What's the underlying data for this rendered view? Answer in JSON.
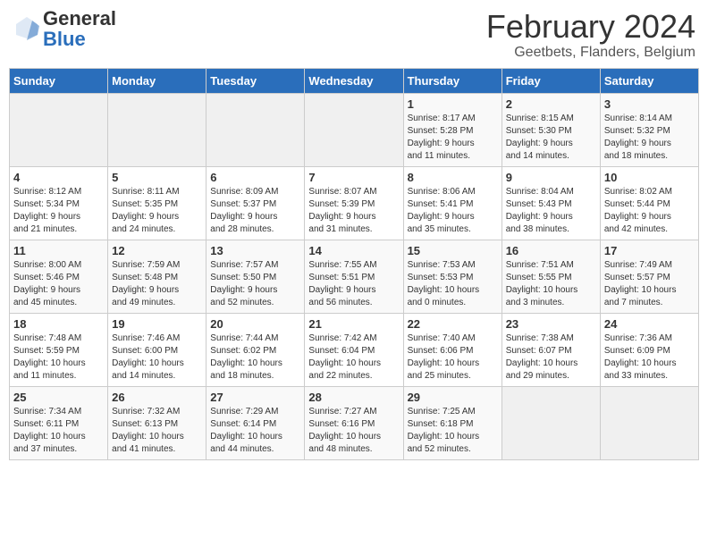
{
  "logo": {
    "general": "General",
    "blue": "Blue"
  },
  "header": {
    "month": "February 2024",
    "location": "Geetbets, Flanders, Belgium"
  },
  "weekdays": [
    "Sunday",
    "Monday",
    "Tuesday",
    "Wednesday",
    "Thursday",
    "Friday",
    "Saturday"
  ],
  "weeks": [
    [
      {
        "day": "",
        "info": ""
      },
      {
        "day": "",
        "info": ""
      },
      {
        "day": "",
        "info": ""
      },
      {
        "day": "",
        "info": ""
      },
      {
        "day": "1",
        "info": "Sunrise: 8:17 AM\nSunset: 5:28 PM\nDaylight: 9 hours\nand 11 minutes."
      },
      {
        "day": "2",
        "info": "Sunrise: 8:15 AM\nSunset: 5:30 PM\nDaylight: 9 hours\nand 14 minutes."
      },
      {
        "day": "3",
        "info": "Sunrise: 8:14 AM\nSunset: 5:32 PM\nDaylight: 9 hours\nand 18 minutes."
      }
    ],
    [
      {
        "day": "4",
        "info": "Sunrise: 8:12 AM\nSunset: 5:34 PM\nDaylight: 9 hours\nand 21 minutes."
      },
      {
        "day": "5",
        "info": "Sunrise: 8:11 AM\nSunset: 5:35 PM\nDaylight: 9 hours\nand 24 minutes."
      },
      {
        "day": "6",
        "info": "Sunrise: 8:09 AM\nSunset: 5:37 PM\nDaylight: 9 hours\nand 28 minutes."
      },
      {
        "day": "7",
        "info": "Sunrise: 8:07 AM\nSunset: 5:39 PM\nDaylight: 9 hours\nand 31 minutes."
      },
      {
        "day": "8",
        "info": "Sunrise: 8:06 AM\nSunset: 5:41 PM\nDaylight: 9 hours\nand 35 minutes."
      },
      {
        "day": "9",
        "info": "Sunrise: 8:04 AM\nSunset: 5:43 PM\nDaylight: 9 hours\nand 38 minutes."
      },
      {
        "day": "10",
        "info": "Sunrise: 8:02 AM\nSunset: 5:44 PM\nDaylight: 9 hours\nand 42 minutes."
      }
    ],
    [
      {
        "day": "11",
        "info": "Sunrise: 8:00 AM\nSunset: 5:46 PM\nDaylight: 9 hours\nand 45 minutes."
      },
      {
        "day": "12",
        "info": "Sunrise: 7:59 AM\nSunset: 5:48 PM\nDaylight: 9 hours\nand 49 minutes."
      },
      {
        "day": "13",
        "info": "Sunrise: 7:57 AM\nSunset: 5:50 PM\nDaylight: 9 hours\nand 52 minutes."
      },
      {
        "day": "14",
        "info": "Sunrise: 7:55 AM\nSunset: 5:51 PM\nDaylight: 9 hours\nand 56 minutes."
      },
      {
        "day": "15",
        "info": "Sunrise: 7:53 AM\nSunset: 5:53 PM\nDaylight: 10 hours\nand 0 minutes."
      },
      {
        "day": "16",
        "info": "Sunrise: 7:51 AM\nSunset: 5:55 PM\nDaylight: 10 hours\nand 3 minutes."
      },
      {
        "day": "17",
        "info": "Sunrise: 7:49 AM\nSunset: 5:57 PM\nDaylight: 10 hours\nand 7 minutes."
      }
    ],
    [
      {
        "day": "18",
        "info": "Sunrise: 7:48 AM\nSunset: 5:59 PM\nDaylight: 10 hours\nand 11 minutes."
      },
      {
        "day": "19",
        "info": "Sunrise: 7:46 AM\nSunset: 6:00 PM\nDaylight: 10 hours\nand 14 minutes."
      },
      {
        "day": "20",
        "info": "Sunrise: 7:44 AM\nSunset: 6:02 PM\nDaylight: 10 hours\nand 18 minutes."
      },
      {
        "day": "21",
        "info": "Sunrise: 7:42 AM\nSunset: 6:04 PM\nDaylight: 10 hours\nand 22 minutes."
      },
      {
        "day": "22",
        "info": "Sunrise: 7:40 AM\nSunset: 6:06 PM\nDaylight: 10 hours\nand 25 minutes."
      },
      {
        "day": "23",
        "info": "Sunrise: 7:38 AM\nSunset: 6:07 PM\nDaylight: 10 hours\nand 29 minutes."
      },
      {
        "day": "24",
        "info": "Sunrise: 7:36 AM\nSunset: 6:09 PM\nDaylight: 10 hours\nand 33 minutes."
      }
    ],
    [
      {
        "day": "25",
        "info": "Sunrise: 7:34 AM\nSunset: 6:11 PM\nDaylight: 10 hours\nand 37 minutes."
      },
      {
        "day": "26",
        "info": "Sunrise: 7:32 AM\nSunset: 6:13 PM\nDaylight: 10 hours\nand 41 minutes."
      },
      {
        "day": "27",
        "info": "Sunrise: 7:29 AM\nSunset: 6:14 PM\nDaylight: 10 hours\nand 44 minutes."
      },
      {
        "day": "28",
        "info": "Sunrise: 7:27 AM\nSunset: 6:16 PM\nDaylight: 10 hours\nand 48 minutes."
      },
      {
        "day": "29",
        "info": "Sunrise: 7:25 AM\nSunset: 6:18 PM\nDaylight: 10 hours\nand 52 minutes."
      },
      {
        "day": "",
        "info": ""
      },
      {
        "day": "",
        "info": ""
      }
    ]
  ]
}
